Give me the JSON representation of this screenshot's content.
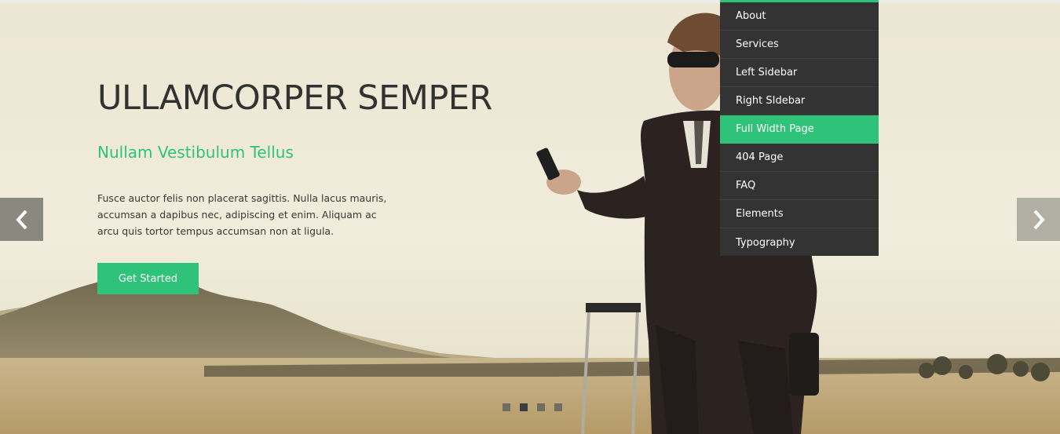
{
  "hero": {
    "title": "ULLAMCORPER SEMPER",
    "subtitle": "Nullam Vestibulum Tellus",
    "description": "Fusce auctor felis non placerat sagittis. Nulla lacus mauris, accumsan a dapibus nec, adipiscing et enim. Aliquam ac arcu quis tortor tempus accumsan non at ligula.",
    "cta_label": "Get Started"
  },
  "slider": {
    "prev_icon": "chevron-left-icon",
    "next_icon": "chevron-right-icon",
    "slide_count": 4,
    "active_slide": 2
  },
  "dropdown_menu": {
    "items": [
      {
        "label": "About",
        "active": false
      },
      {
        "label": "Services",
        "active": false
      },
      {
        "label": "Left Sidebar",
        "active": false
      },
      {
        "label": "Right SIdebar",
        "active": false
      },
      {
        "label": "Full Width Page",
        "active": true
      },
      {
        "label": "404 Page",
        "active": false
      },
      {
        "label": "FAQ",
        "active": false
      },
      {
        "label": "Elements",
        "active": false
      },
      {
        "label": "Typography",
        "active": false
      }
    ]
  },
  "colors": {
    "accent": "#2fc37a",
    "menu_background": "#333333",
    "title_text": "#333230",
    "body_text": "#3a3733"
  }
}
